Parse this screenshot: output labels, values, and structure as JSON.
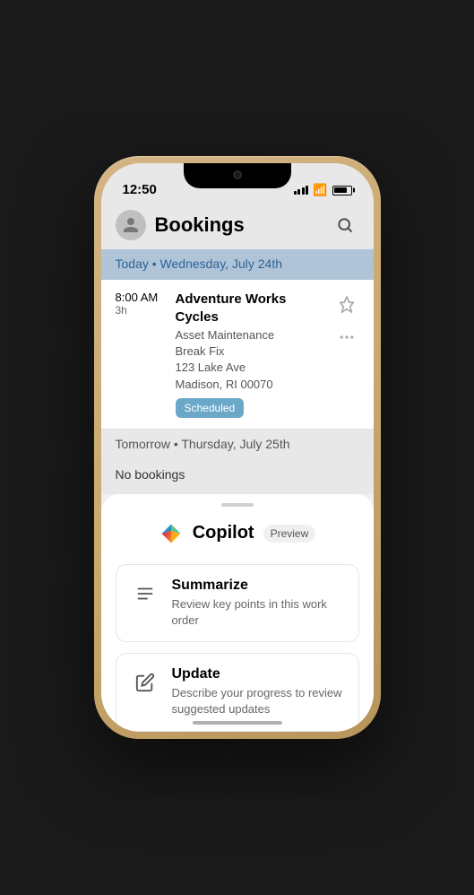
{
  "status_bar": {
    "time": "12:50"
  },
  "header": {
    "title": "Bookings",
    "search_label": "Search"
  },
  "today_section": {
    "label": "Today • Wednesday, July 24th"
  },
  "booking": {
    "time": "8:00 AM",
    "duration": "3h",
    "company": "Adventure Works Cycles",
    "service": "Asset Maintenance",
    "task": "Break Fix",
    "address1": "123 Lake Ave",
    "address2": "Madison, RI 00070",
    "status": "Scheduled"
  },
  "tomorrow_section": {
    "label": "Tomorrow • Thursday, July 25th",
    "no_bookings": "No bookings"
  },
  "copilot": {
    "title": "Copilot",
    "preview_label": "Preview"
  },
  "actions": [
    {
      "id": "summarize",
      "title": "Summarize",
      "description": "Review key points in this work order",
      "icon": "summarize-icon"
    },
    {
      "id": "update",
      "title": "Update",
      "description": "Describe your progress to review suggested updates",
      "icon": "update-icon"
    }
  ]
}
